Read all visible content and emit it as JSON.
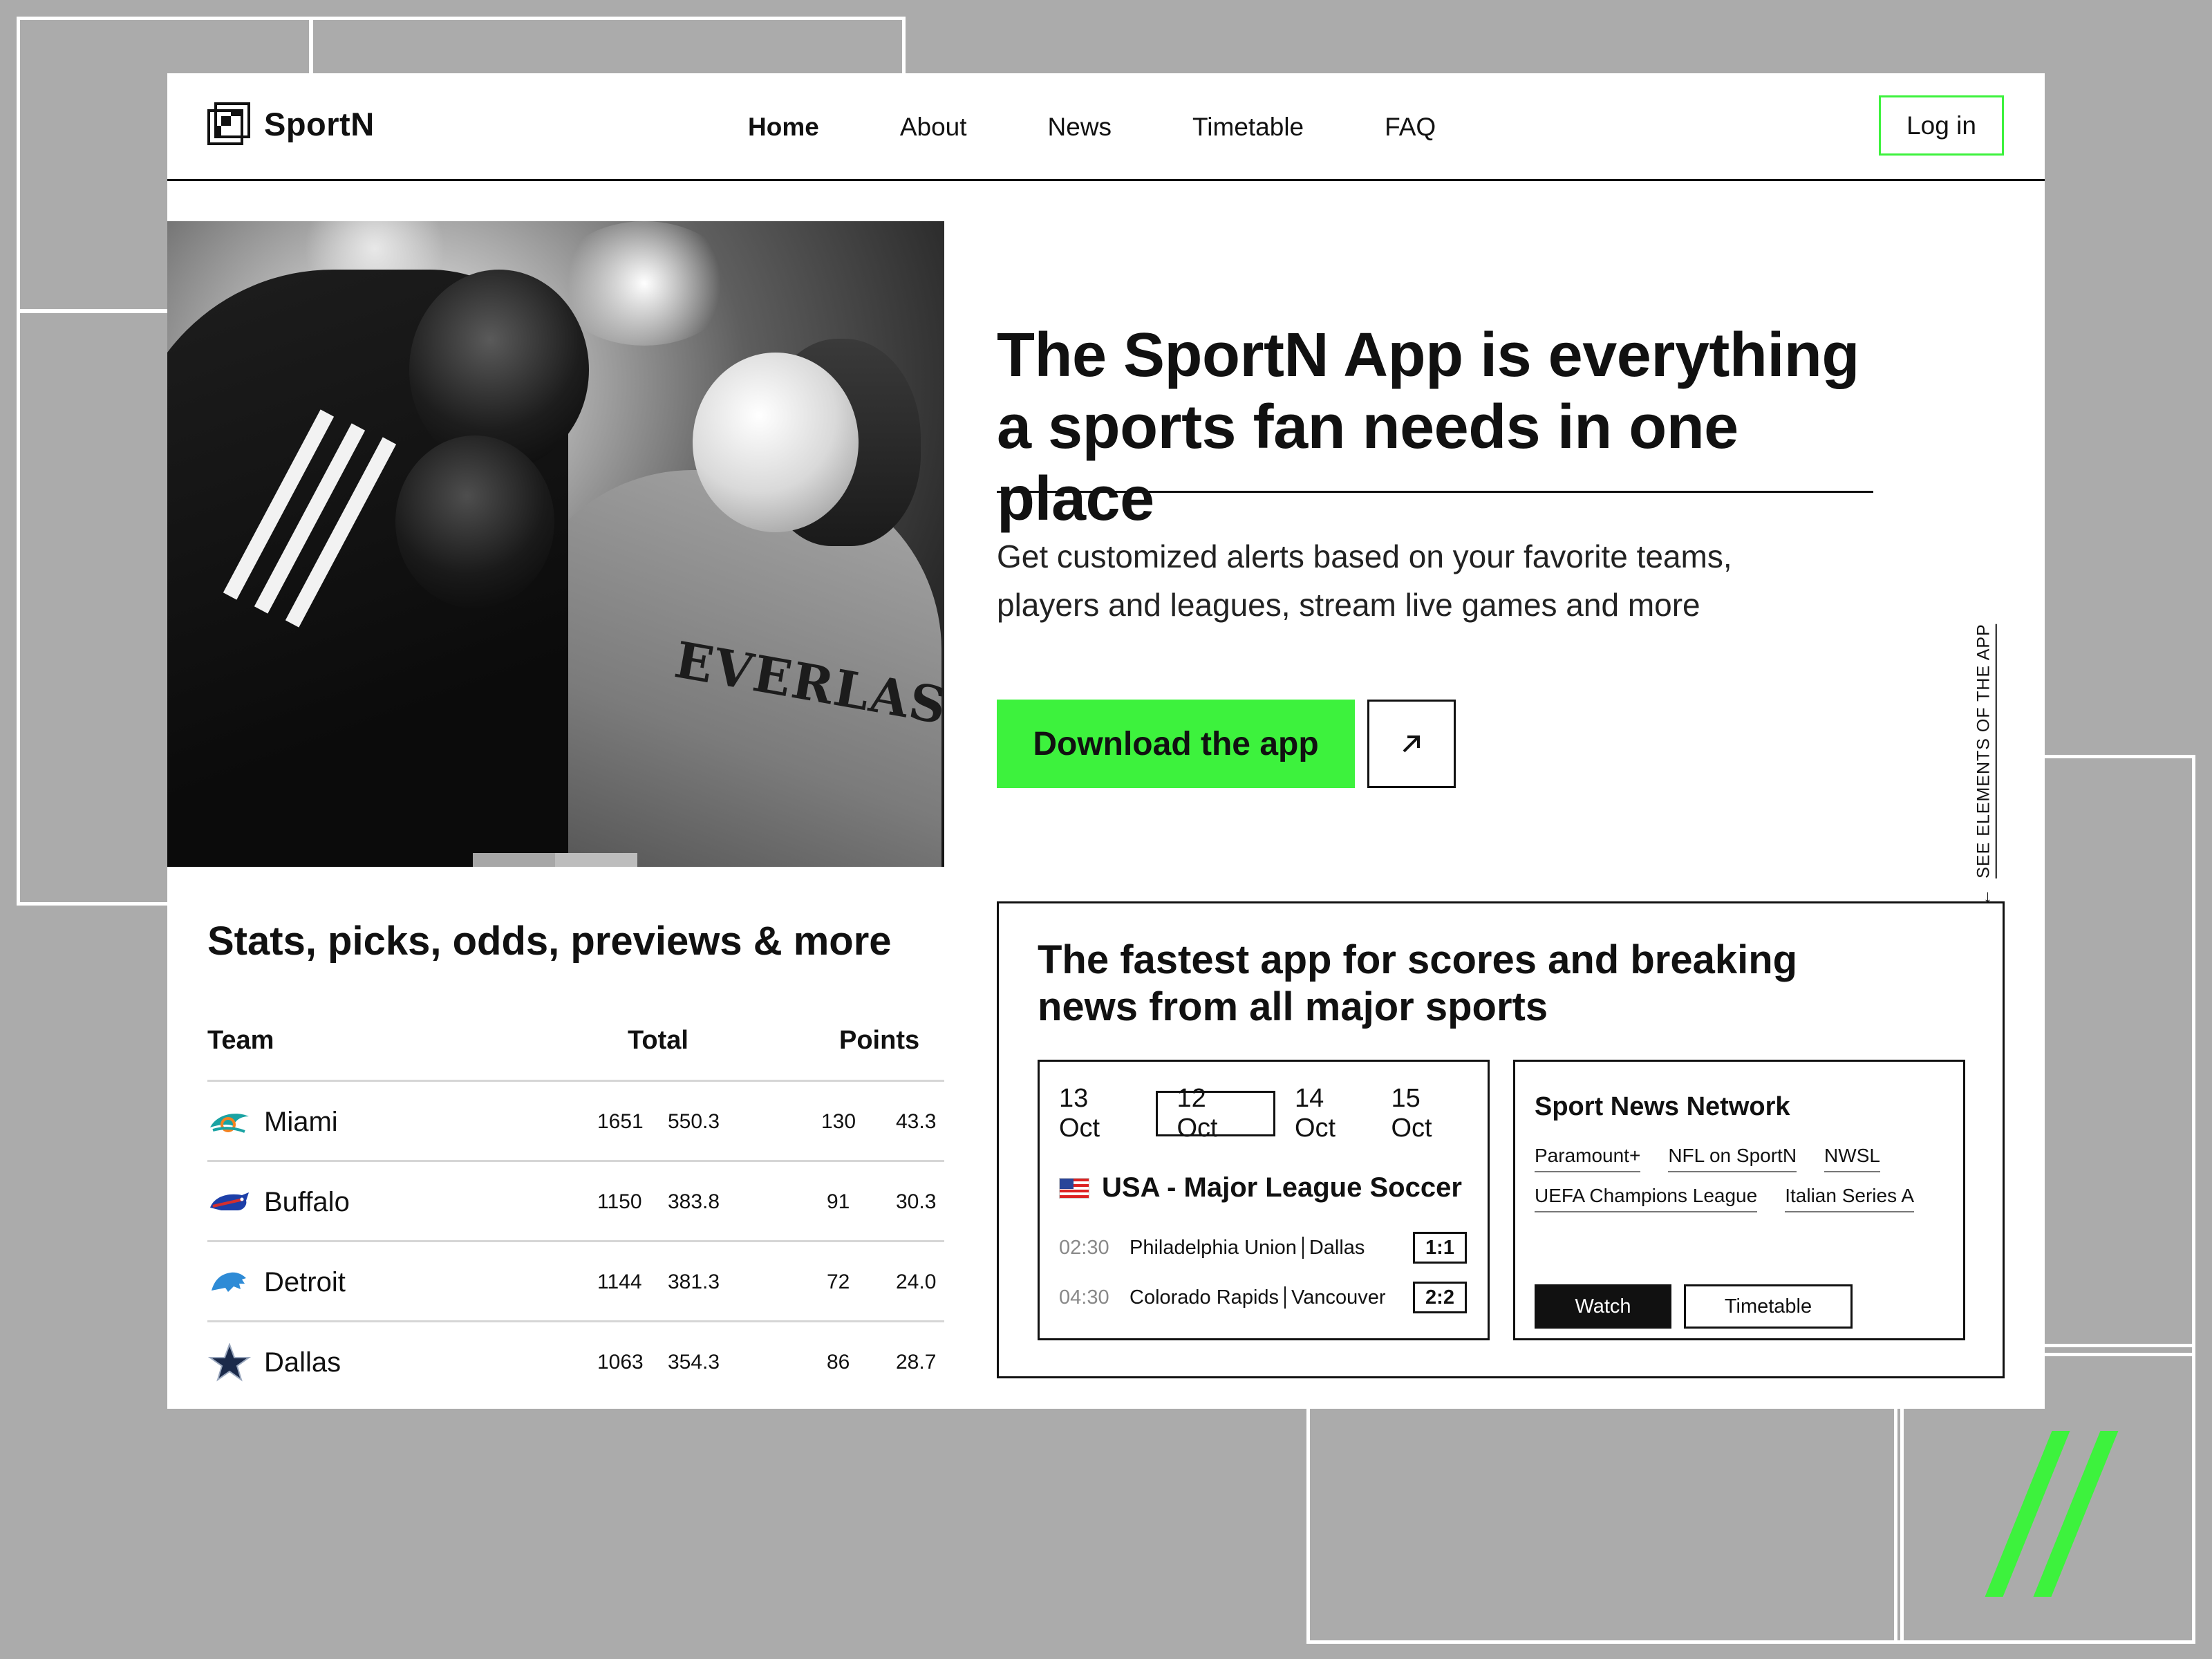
{
  "app": {
    "name": "SportN"
  },
  "nav": {
    "items": [
      "Home",
      "About",
      "News",
      "Timetable",
      "FAQ"
    ],
    "active": "Home",
    "login": "Log in"
  },
  "hero": {
    "title": "The SportN App is everything a sports fan needs in one place",
    "subtitle": "Get customized alerts based on your favorite teams, players and leagues, stream live games and more",
    "cta": "Download the app",
    "side_link": "SEE ELEMENTS OF THE APP",
    "photo_text": "EVERLAST"
  },
  "stats": {
    "title": "Stats, picks, odds, previews & more",
    "columns": [
      "Team",
      "Total",
      "Points"
    ],
    "rows": [
      {
        "team": "Miami",
        "total_a": "1651",
        "total_b": "550.3",
        "points_a": "130",
        "points_b": "43.3",
        "icon": "dolphins-logo-icon"
      },
      {
        "team": "Buffalo",
        "total_a": "1150",
        "total_b": "383.8",
        "points_a": "91",
        "points_b": "30.3",
        "icon": "bills-logo-icon"
      },
      {
        "team": "Detroit",
        "total_a": "1144",
        "total_b": "381.3",
        "points_a": "72",
        "points_b": "24.0",
        "icon": "lions-logo-icon"
      },
      {
        "team": "Dallas",
        "total_a": "1063",
        "total_b": "354.3",
        "points_a": "86",
        "points_b": "28.7",
        "icon": "star-logo-icon"
      }
    ]
  },
  "scores": {
    "title": "The fastest app for scores and breaking news from all major sports",
    "dates": [
      "13 Oct",
      "12 Oct",
      "14 Oct",
      "15 Oct"
    ],
    "active_date": "12 Oct",
    "league": "USA - Major League Soccer",
    "matches": [
      {
        "time": "02:30",
        "home": "Philadelphia Union",
        "away": "Dallas",
        "score": "1:1"
      },
      {
        "time": "04:30",
        "home": "Colorado Rapids",
        "away": "Vancouver",
        "score": "2:2"
      }
    ]
  },
  "network": {
    "title": "Sport News Network",
    "channels": [
      "Paramount+",
      "NFL on SportN",
      "NWSL",
      "UEFA Champions League",
      "Italian Series A"
    ],
    "watch": "Watch",
    "timetable": "Timetable"
  },
  "colors": {
    "accent": "#3df23d",
    "background": "#ababab",
    "card": "#ffffff",
    "ink": "#111111"
  }
}
